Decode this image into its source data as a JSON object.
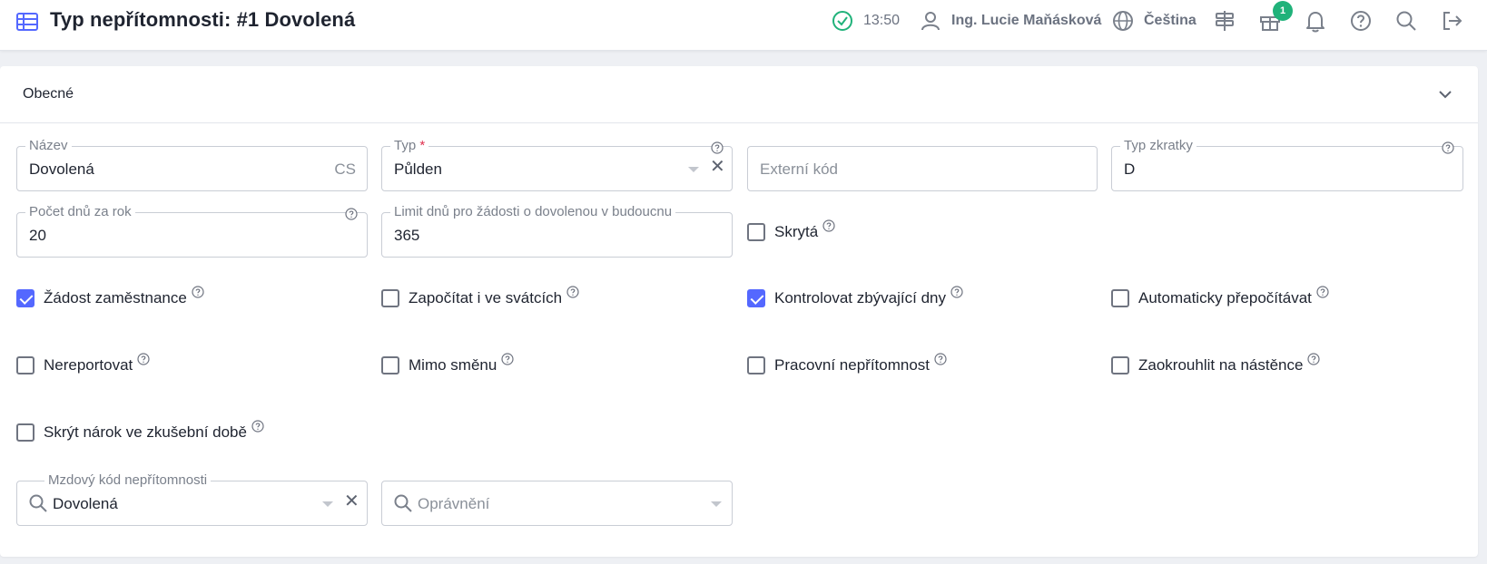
{
  "header": {
    "title": "Typ nepřítomnosti: #1 Dovolená",
    "time": "13:50",
    "user": "Ing. Lucie Maňásková",
    "language": "Čeština",
    "notification_count": "1"
  },
  "section": {
    "title": "Obecné"
  },
  "fields": {
    "nazev": {
      "label": "Název",
      "value": "Dovolená",
      "suffix": "CS"
    },
    "typ": {
      "label": "Typ",
      "required": "*",
      "value": "Půlden"
    },
    "externi_kod": {
      "placeholder": "Externí kód"
    },
    "typ_zkratky": {
      "label": "Typ zkratky",
      "value": "D"
    },
    "pocet_dnu": {
      "label": "Počet dnů za rok",
      "value": "20"
    },
    "limit_dnu": {
      "label": "Limit dnů pro žádosti o dovolenou v budoucnu",
      "value": "365"
    },
    "mzdovy_kod": {
      "label": "Mzdový kód nepřítomnosti",
      "value": "Dovolená"
    },
    "opravneni": {
      "placeholder": "Oprávnění"
    }
  },
  "checkboxes": [
    {
      "label": "Skrytá",
      "checked": false
    },
    {
      "label": "Žádost zaměstnance",
      "checked": true
    },
    {
      "label": "Započítat i ve svátcích",
      "checked": false
    },
    {
      "label": "Kontrolovat zbývající dny",
      "checked": true
    },
    {
      "label": "Automaticky přepočítávat",
      "checked": false
    },
    {
      "label": "Nereportovat",
      "checked": false
    },
    {
      "label": "Mimo směnu",
      "checked": false
    },
    {
      "label": "Pracovní nepřítomnost",
      "checked": false
    },
    {
      "label": "Zaokrouhlit na nástěnce",
      "checked": false
    },
    {
      "label": "Skrýt nárok ve zkušební době",
      "checked": false
    }
  ],
  "colors": {
    "accent": "#5468ff",
    "success": "#20b27a",
    "required": "#e0304e"
  },
  "icons": [
    "table-icon",
    "check-circle-icon",
    "user-icon",
    "globe-icon",
    "signpost-icon",
    "gift-icon",
    "bell-icon",
    "help-circle-icon",
    "search-icon",
    "logout-icon",
    "chevron-down-icon",
    "clear-icon",
    "caret-down-icon"
  ]
}
